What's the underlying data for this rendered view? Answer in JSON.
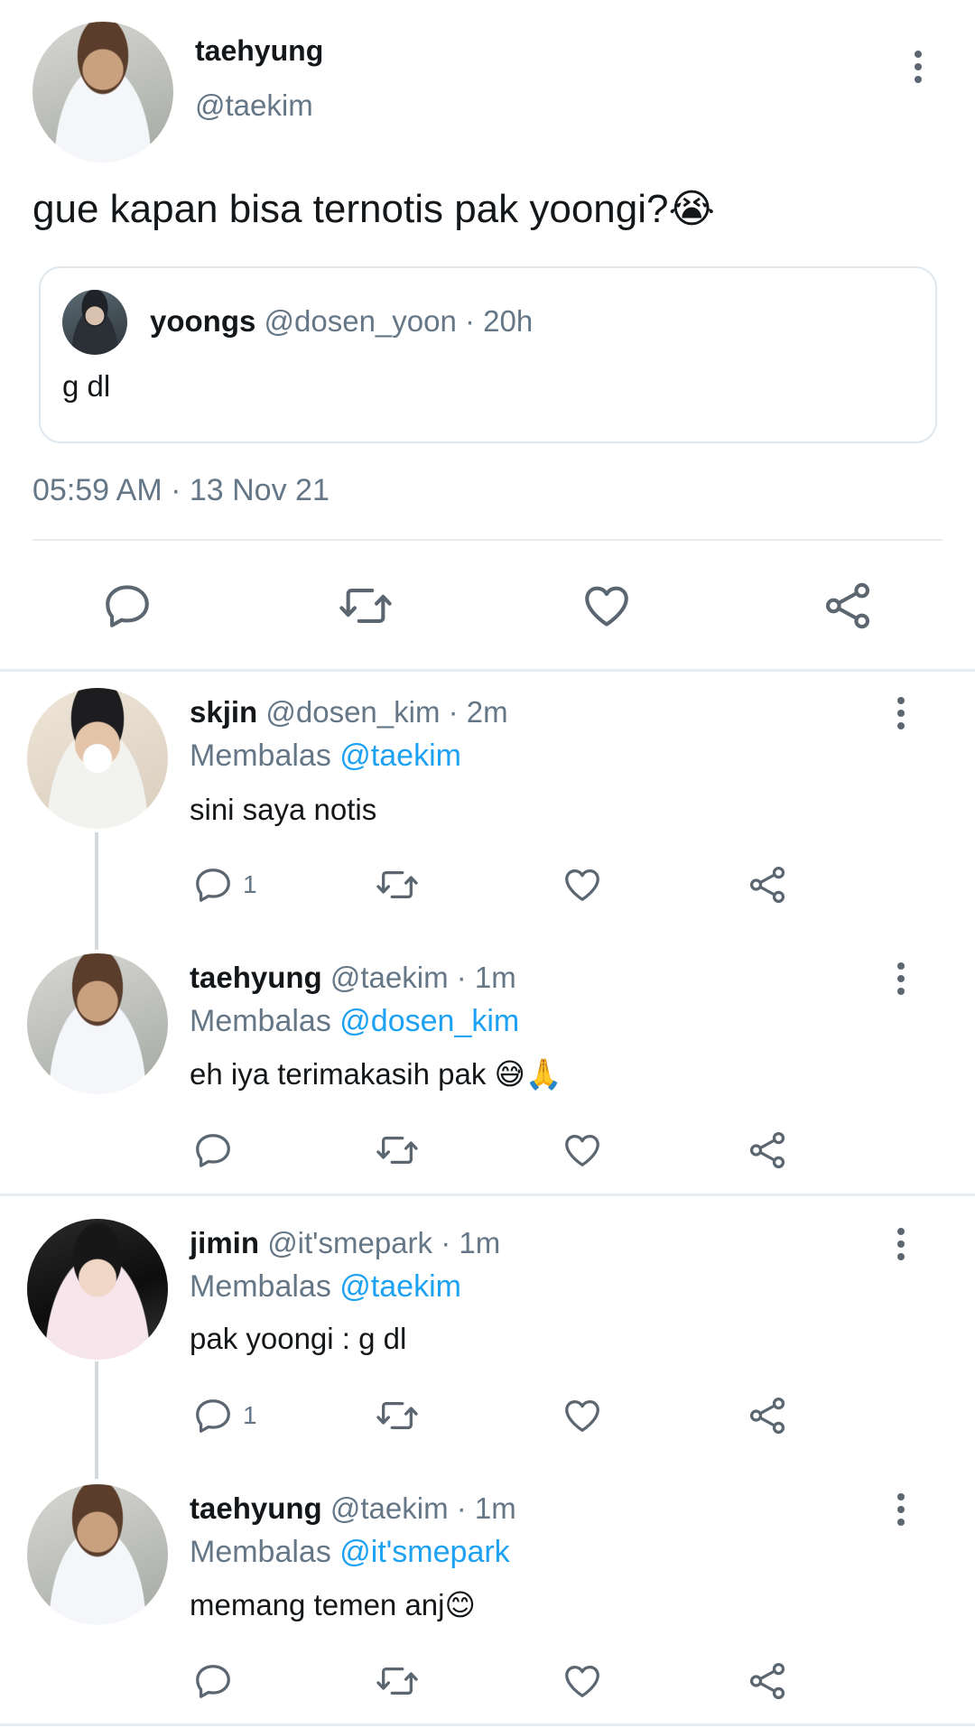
{
  "tweet": {
    "display_name": "taehyung",
    "handle": "@taekim",
    "text": "gue kapan bisa ternotis pak yoongi?😭",
    "timestamp": "05:59 AM · 13 Nov 21",
    "quoted": {
      "display_name": "yoongs",
      "handle": "@dosen_yoon",
      "time": "· 20h",
      "text": "g dl"
    }
  },
  "actions": {
    "reply_icon": "reply-icon",
    "retweet_icon": "retweet-icon",
    "like_icon": "heart-icon",
    "share_icon": "share-icon"
  },
  "replies": [
    {
      "display_name": "skjin",
      "handle": "@dosen_kim",
      "time": "· 2m",
      "replying_prefix": "Membalas",
      "replying_to": "@taekim",
      "text": "sini saya notis",
      "reply_count": "1"
    },
    {
      "display_name": "taehyung",
      "handle": "@taekim",
      "time": "· 1m",
      "replying_prefix": "Membalas",
      "replying_to": "@dosen_kim",
      "text": "eh iya terimakasih pak 😅🙏",
      "reply_count": ""
    },
    {
      "display_name": "jimin",
      "handle": "@it'smepark",
      "time": "· 1m",
      "replying_prefix": "Membalas",
      "replying_to": "@taekim",
      "text": "pak yoongi : g dl",
      "reply_count": "1"
    },
    {
      "display_name": "taehyung",
      "handle": "@taekim",
      "time": "· 1m",
      "replying_prefix": "Membalas",
      "replying_to": "@it'smepark",
      "text": "memang temen anj😊",
      "reply_count": ""
    }
  ],
  "colors": {
    "link": "#1da1f2",
    "muted": "#657786",
    "icon": "#5b6670"
  }
}
